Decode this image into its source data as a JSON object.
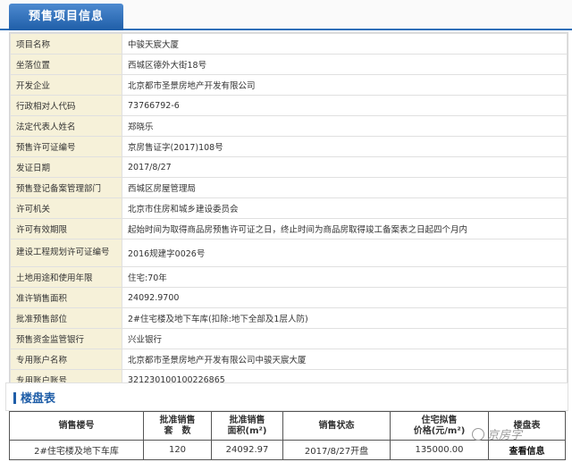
{
  "section_tab": "预售项目信息",
  "info_rows": [
    {
      "label": "项目名称",
      "value": "中骏天宸大厦"
    },
    {
      "label": "坐落位置",
      "value": "西城区德外大街18号"
    },
    {
      "label": "开发企业",
      "value": "北京都市圣景房地产开发有限公司"
    },
    {
      "label": "行政相对人代码",
      "value": "73766792-6"
    },
    {
      "label": "法定代表人姓名",
      "value": "郑晓乐"
    },
    {
      "label": "预售许可证编号",
      "value": "京房售证字(2017)108号"
    },
    {
      "label": "发证日期",
      "value": "2017/8/27"
    },
    {
      "label": "预售登记备案管理部门",
      "value": "西城区房屋管理局"
    },
    {
      "label": "许可机关",
      "value": "北京市住房和城乡建设委员会"
    },
    {
      "label": "许可有效期限",
      "value": "起始时间为取得商品房预售许可证之日，终止时间为商品房取得竣工备案表之日起四个月内"
    },
    {
      "label": "建设工程规划许可证编号",
      "value": "2016规建字0026号"
    },
    {
      "label": "土地用途和使用年限",
      "value": "住宅:70年"
    },
    {
      "label": "准许销售面积",
      "value": "24092.9700"
    },
    {
      "label": "批准预售部位",
      "value": "2#住宅楼及地下车库(扣除:地下全部及1层人防)"
    },
    {
      "label": "预售资金监管银行",
      "value": "兴业银行"
    },
    {
      "label": "专用账户名称",
      "value": "北京都市圣景房地产开发有限公司中骏天宸大厦"
    },
    {
      "label": "专用账户账号",
      "value": "321230100100226865"
    }
  ],
  "loupan": {
    "title": "楼盘表",
    "headers": {
      "building": "销售楼号",
      "sets": "批准销售套 数",
      "area": "批准销售面积(m²)",
      "status": "销售状态",
      "price": "住宅拟售价格(元/m²)",
      "table": "楼盘表"
    },
    "row": {
      "building": "2#住宅楼及地下车库",
      "sets": "120",
      "area": "24092.97",
      "status": "2017/8/27开盘",
      "price": "135000.00",
      "link": "查看信息"
    }
  },
  "watermark": "京房字"
}
